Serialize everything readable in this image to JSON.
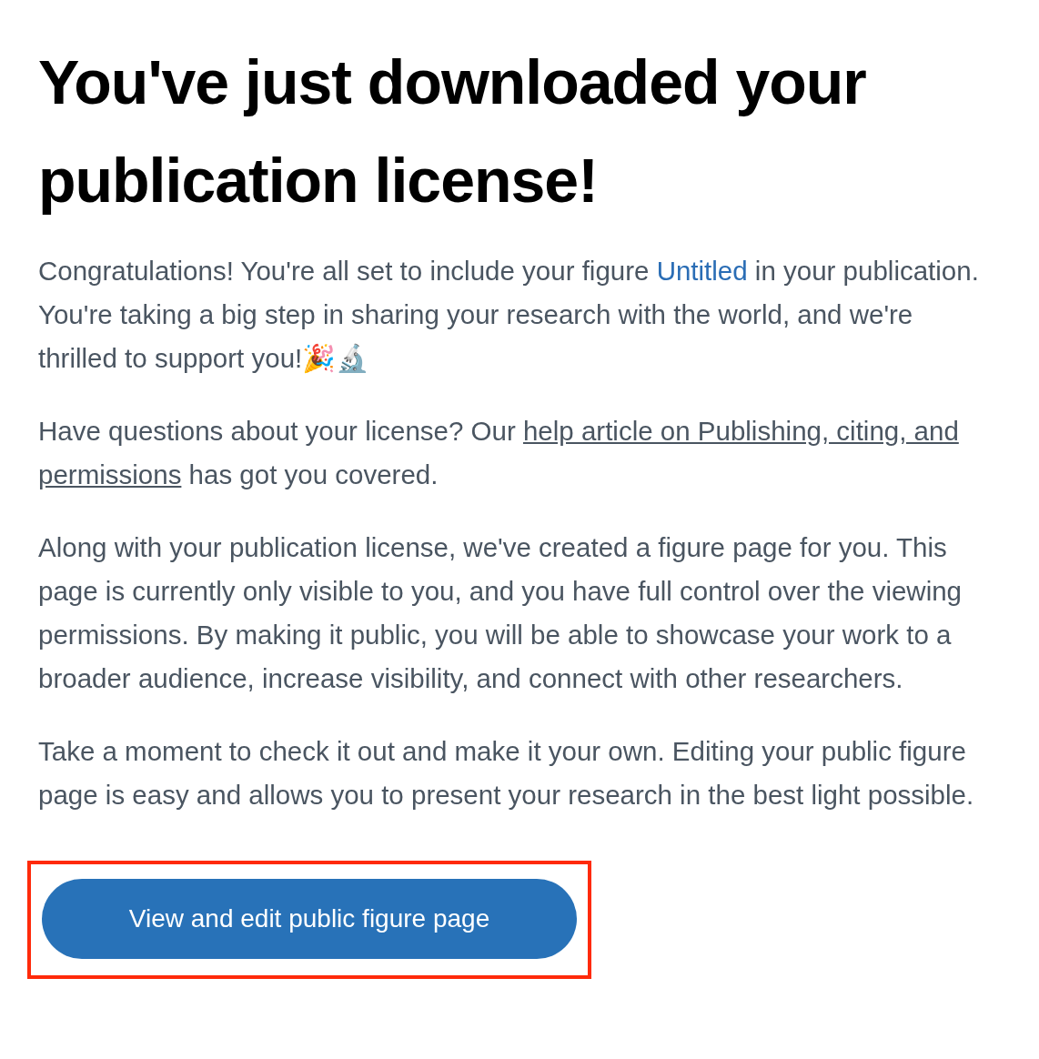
{
  "heading": "You've just downloaded your publication license!",
  "paragraphs": [
    {
      "parts": [
        {
          "kind": "text",
          "text": "Congratulations! You're all set to include your figure "
        },
        {
          "kind": "link",
          "text": "Untitled"
        },
        {
          "kind": "text",
          "text": " in your publication. You're taking a big step in sharing your research with the world, and we're thrilled to support you!🎉🔬"
        }
      ]
    },
    {
      "parts": [
        {
          "kind": "text",
          "text": "Have questions about your license? Our "
        },
        {
          "kind": "underlined-link",
          "text": "help article on Publishing, citing, and "
        },
        {
          "kind": "underlined-link",
          "text": "permissions"
        },
        {
          "kind": "text",
          "text": " has got you covered."
        }
      ]
    },
    {
      "parts": [
        {
          "kind": "text",
          "text": "Along with your publication license, we've created a figure page for you. This page is currently only visible to you, and you have full control over the viewing permissions. By making it public, you will be able to showcase your work to a broader audience, increase visibility, and connect with other researchers."
        }
      ]
    },
    {
      "parts": [
        {
          "kind": "text",
          "text": "Take a moment to check it out and make it your own. Editing your public figure page is easy and allows you to present your research in the best light possible."
        }
      ]
    }
  ],
  "button": {
    "label": "View and edit public figure page",
    "highlighted": true
  }
}
